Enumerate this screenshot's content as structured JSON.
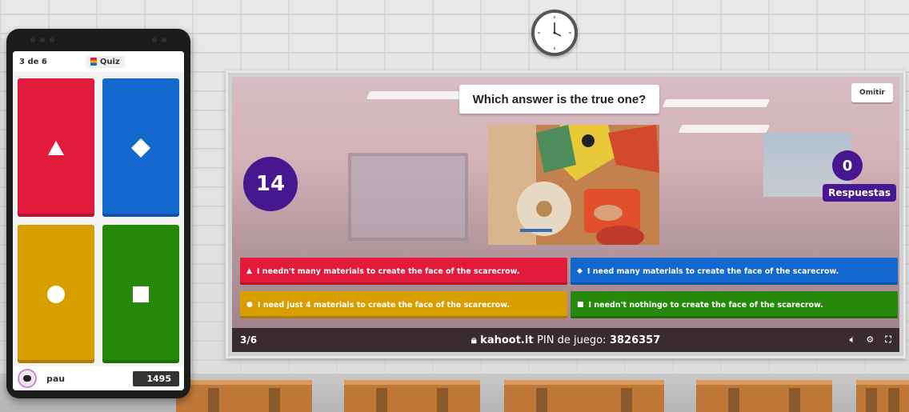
{
  "clock": {
    "label": "wall-clock"
  },
  "phone": {
    "progress": "3 de 6",
    "mode_label": "Quiz",
    "tiles": [
      {
        "shape": "triangle",
        "color": "#e21b3c",
        "glyph": "▲"
      },
      {
        "shape": "diamond",
        "color": "#1368ce",
        "glyph": "◆"
      },
      {
        "shape": "circle",
        "color": "#d89e00",
        "glyph": "●"
      },
      {
        "shape": "square",
        "color": "#26890c",
        "glyph": "■"
      }
    ],
    "player_name": "pau",
    "score": "1495"
  },
  "game": {
    "question": "Which answer is the true one?",
    "skip_label": "Omitir",
    "timer": "14",
    "answers_count": "0",
    "answers_label": "Respuestas",
    "answers": [
      {
        "shape": "▲",
        "text": "I needn't many materials to create the face of the scarecrow.",
        "color": "#e21b3c"
      },
      {
        "shape": "◆",
        "text": "I need many materials to create the face of the scarecrow.",
        "color": "#1368ce"
      },
      {
        "shape": "●",
        "text": "I need just 4 materials to create the face of the scarecrow.",
        "color": "#d89e00"
      },
      {
        "shape": "■",
        "text": "I needn't nothingo to create the face of the scarecrow.",
        "color": "#26890c"
      }
    ],
    "footer": {
      "progress": "3/6",
      "site": "kahoot.it",
      "pin_label": "PIN de juego:",
      "pin": "3826357"
    }
  },
  "icons": [
    "lock-icon",
    "volume-icon",
    "settings-icon",
    "fullscreen-icon",
    "quiz-icon",
    "avatar-icon"
  ]
}
